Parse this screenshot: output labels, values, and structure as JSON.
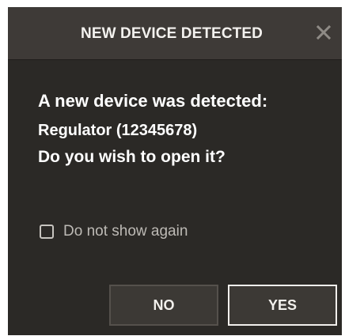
{
  "dialog": {
    "title": "NEW DEVICE DETECTED",
    "close_icon": "close-icon",
    "message_line1": "A new device was detected:",
    "message_line2": "Regulator (12345678)",
    "message_line3": "Do you wish to open it?",
    "checkbox_label": "Do not show again",
    "checkbox_checked": false,
    "no_label": "NO",
    "yes_label": "YES"
  },
  "colors": {
    "dialog_bg": "#2b2926",
    "titlebar_bg": "#3e3a37",
    "text": "#ffffff",
    "muted_text": "#bdbab5",
    "yes_border": "#f1efec",
    "no_border": "#55514c"
  }
}
